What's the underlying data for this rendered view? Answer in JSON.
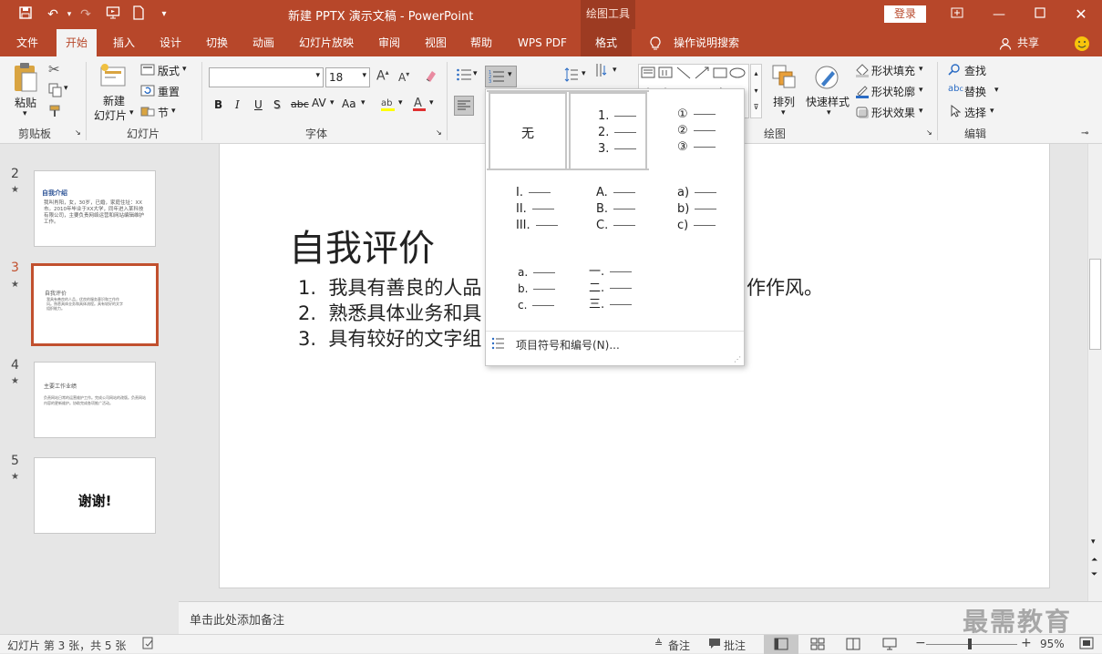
{
  "window": {
    "title": "新建 PPTX 演示文稿  -  PowerPoint",
    "context_tools": "绘图工具",
    "login": "登录"
  },
  "tabs": [
    "文件",
    "开始",
    "插入",
    "设计",
    "切换",
    "动画",
    "幻灯片放映",
    "审阅",
    "视图",
    "帮助",
    "WPS PDF",
    "格式"
  ],
  "tell_me": "操作说明搜索",
  "share": "共享",
  "ribbon": {
    "clipboard": {
      "paste": "粘贴",
      "label": "剪贴板"
    },
    "slides": {
      "new_slide_1": "新建",
      "new_slide_2": "幻灯片",
      "layout": "版式",
      "reset": "重置",
      "section": "节",
      "label": "幻灯片"
    },
    "font": {
      "font_name": "",
      "font_size": "18",
      "bold": "B",
      "italic": "I",
      "underline": "U",
      "shadow": "S",
      "strike": "abc",
      "spacing": "AV",
      "case": "Aa",
      "label": "字体"
    },
    "drawing": {
      "arrange": "排列",
      "quick_styles": "快速样式",
      "fill": "形状填充",
      "outline": "形状轮廓",
      "effects": "形状效果",
      "label": "绘图"
    },
    "editing": {
      "find": "查找",
      "replace": "替换",
      "select": "选择",
      "label": "编辑"
    }
  },
  "numbering_dropdown": {
    "none": "无",
    "opt_arabic": [
      "1.",
      "2.",
      "3."
    ],
    "opt_circled": [
      "①",
      "②",
      "③"
    ],
    "opt_roman": [
      "I.",
      "II.",
      "III."
    ],
    "opt_upper": [
      "A.",
      "B.",
      "C."
    ],
    "opt_paren": [
      "a)",
      "b)",
      "c)"
    ],
    "opt_lower": [
      "a.",
      "b.",
      "c."
    ],
    "opt_chinese": [
      "一.",
      "二.",
      "三."
    ],
    "footer": "项目符号和编号(N)..."
  },
  "thumbnails": [
    {
      "num": "2",
      "title": "自我介绍",
      "body": "我叫肖阳，女，30岁，已婚，家庭住址：XX市。2010年毕业于XX大学，同年进入某科技有限公司，主要负责网络运营和网站编辑维护工作。"
    },
    {
      "num": "3",
      "title": "自我评价",
      "body": "我具有善良的人品，优良的服务意识和工作作风。熟悉具体业务和具体流程。具有较好的文字组织能力。"
    },
    {
      "num": "4",
      "title": "主要工作业绩",
      "body": "负责网站日常的运营维护工作。完成公司网站的改版。负责网站内容的更新维护。协助完成各项推广活动。"
    },
    {
      "num": "5",
      "title": "谢谢!",
      "body": ""
    }
  ],
  "slide": {
    "title": "自我评价",
    "items": [
      {
        "num": "1.",
        "text": "我具有善良的人品",
        "tail": "作作风。"
      },
      {
        "num": "2.",
        "text": "熟悉具体业务和具",
        "tail": ""
      },
      {
        "num": "3.",
        "text": "具有较好的文字组",
        "tail": ""
      }
    ]
  },
  "notes_placeholder": "单击此处添加备注",
  "status": {
    "slide_info": "幻灯片 第 3 张，共 5 张",
    "notes": "备注",
    "comments": "批注",
    "zoom": "95%"
  },
  "watermark": "最需教育",
  "colors": {
    "accent": "#b7472a",
    "selected": "#c1502e"
  }
}
